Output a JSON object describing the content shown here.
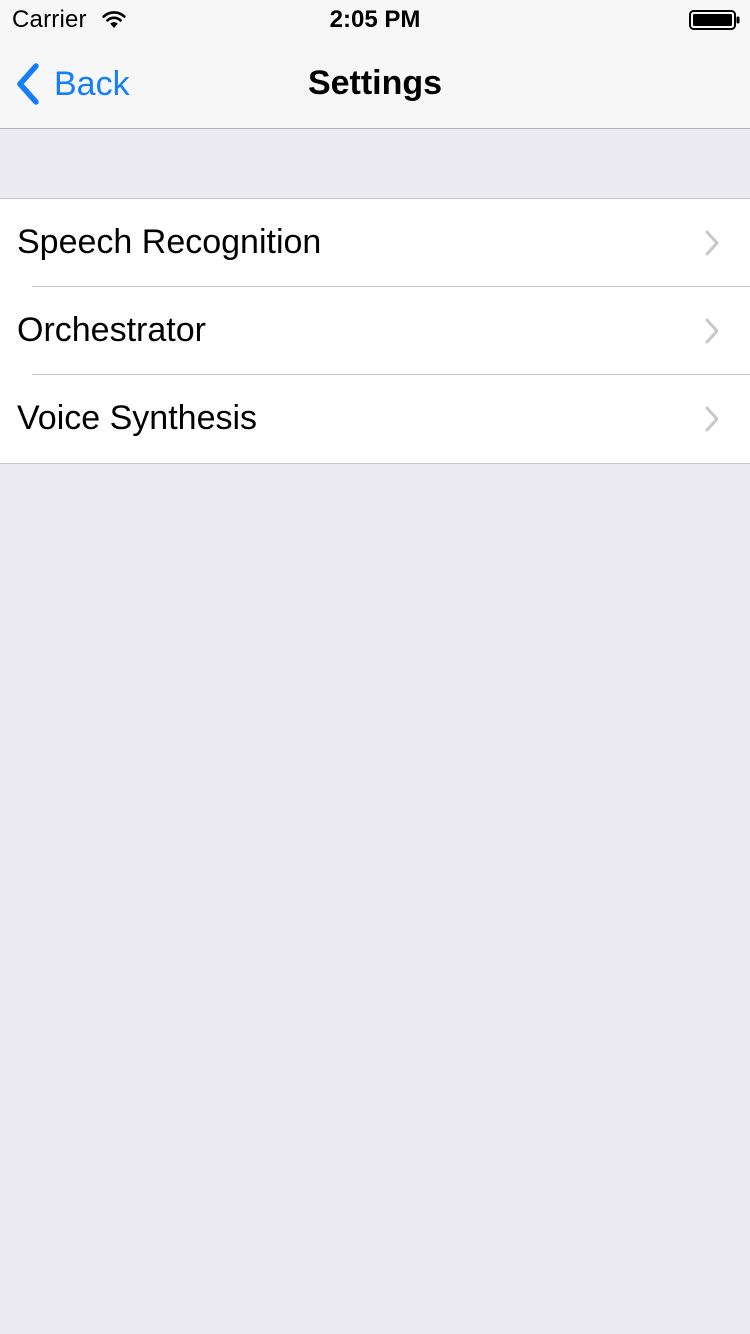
{
  "status_bar": {
    "carrier": "Carrier",
    "time": "2:05 PM",
    "icons": [
      "wifi-icon",
      "battery-icon"
    ]
  },
  "nav_bar": {
    "back_label": "Back",
    "title": "Settings",
    "back_icon": "chevron-left-icon"
  },
  "settings_list": {
    "items": [
      {
        "label": "Speech Recognition",
        "icon": "chevron-right-icon"
      },
      {
        "label": "Orchestrator",
        "icon": "chevron-right-icon"
      },
      {
        "label": "Voice Synthesis",
        "icon": "chevron-right-icon"
      }
    ]
  },
  "colors": {
    "accent": "#157EFB",
    "background": "#EBEBF1",
    "chrome": "#F7F7F7",
    "cell": "#FFFFFF",
    "separator": "#C8C7CC",
    "disclosure": "#C7C7CC"
  }
}
